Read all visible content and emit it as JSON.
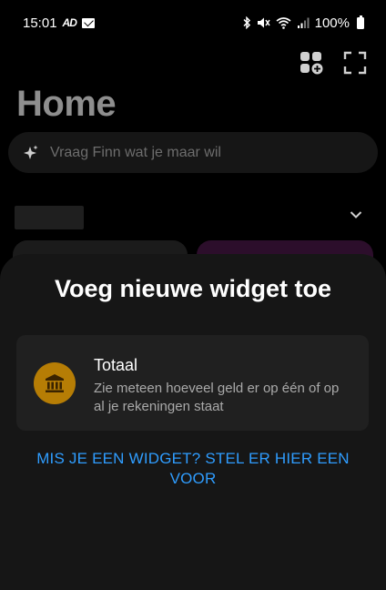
{
  "status_bar": {
    "time": "15:01",
    "app_badge": "AD",
    "battery": "100%"
  },
  "header": {
    "title": "Home",
    "add_widget_icon": "widget-add-icon",
    "fullscreen_icon": "fullscreen-icon"
  },
  "search": {
    "placeholder": "Vraag Finn wat je maar wil",
    "icon": "sparkle-icon"
  },
  "sheet": {
    "title": "Voeg nieuwe widget toe",
    "widgets": [
      {
        "title": "Totaal",
        "description": "Zie meteen hoeveel geld er op één of op al je rekeningen staat",
        "icon": "bank-icon",
        "icon_color": "#b67d05"
      }
    ],
    "suggest_link": "MIS JE EEN WIDGET? STEL ER HIER EEN VOOR"
  },
  "colors": {
    "accent_link": "#2f9dff",
    "sheet_bg": "#161616",
    "card_bg": "#202020"
  }
}
